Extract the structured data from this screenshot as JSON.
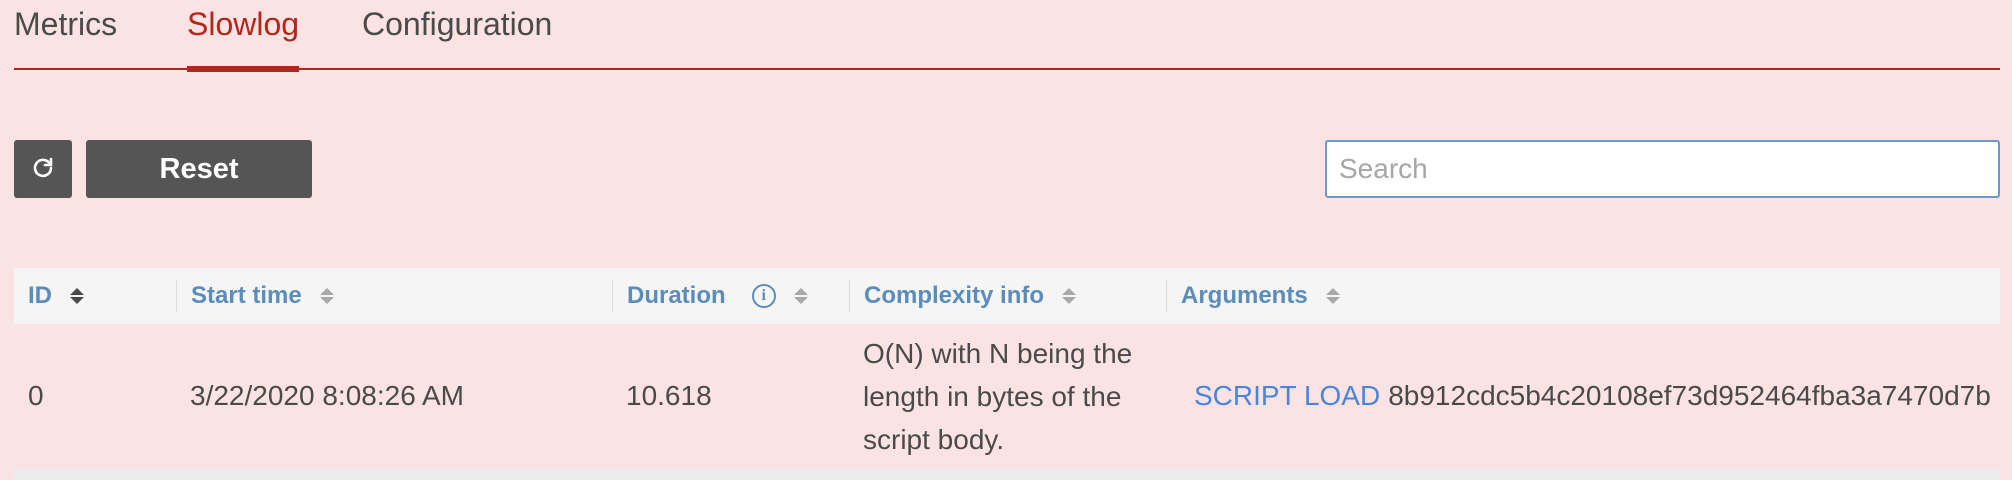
{
  "tabs": [
    {
      "label": "Metrics",
      "active": false
    },
    {
      "label": "Slowlog",
      "active": true
    },
    {
      "label": "Configuration",
      "active": false
    }
  ],
  "toolbar": {
    "refresh_icon": "refresh-icon",
    "reset_label": "Reset",
    "search_placeholder": "Search"
  },
  "table": {
    "columns": [
      "ID",
      "Start time",
      "Duration",
      "Complexity info",
      "Arguments"
    ],
    "duration_info_icon": "info-icon",
    "rows": [
      {
        "id": "0",
        "start_time": "3/22/2020 8:08:26 AM",
        "duration": "10.618",
        "complexity": "O(N) with N being the length in bytes of the script body.",
        "command": "SCRIPT LOAD",
        "args": "8b912cdc5b4c20108ef73d952464fba3a7470d7b"
      }
    ]
  },
  "colors": {
    "background": "#fbe3e3",
    "accent": "#b3261e",
    "header_text": "#5b8db8",
    "command": "#4a86d8",
    "button": "#555555"
  }
}
